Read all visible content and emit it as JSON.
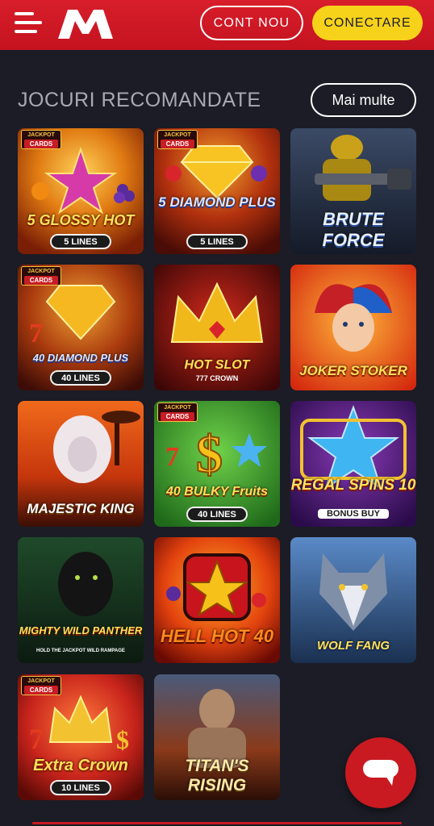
{
  "header": {
    "register_label": "CONT NOU",
    "login_label": "CONECTARE",
    "brand_color": "#d01a26",
    "login_color": "#f7d21b"
  },
  "section": {
    "title": "JOCURI RECOMANDATE",
    "more_label": "Mai multe"
  },
  "games": [
    {
      "name": "5 GLOSSY HOT",
      "badge": "JACKPOT CARDS",
      "lines": "5 LINES"
    },
    {
      "name": "5 DIAMOND PLUS",
      "badge": "JACKPOT CARDS",
      "lines": "5 LINES"
    },
    {
      "name": "BRUTE FORCE"
    },
    {
      "name": "40 DIAMOND PLUS",
      "badge": "JACKPOT CARDS",
      "lines": "40 LINES"
    },
    {
      "name": "HOT SLOT",
      "subtitle": "777 CROWN"
    },
    {
      "name": "JOKER STOKER"
    },
    {
      "name": "MAJESTIC KING"
    },
    {
      "name": "40 BULKY Fruits",
      "badge": "JACKPOT CARDS",
      "lines": "40 LINES"
    },
    {
      "name": "REGAL SPINS 10",
      "subtitle": "BONUS BUY"
    },
    {
      "name": "MIGHTY WILD PANTHER",
      "subtitle": "HOLD THE JACKPOT WILD RAMPAGE"
    },
    {
      "name": "HELL HOT 40"
    },
    {
      "name": "WOLF FANG"
    },
    {
      "name": "Extra Crown",
      "badge": "JACKPOT CARDS",
      "lines": "10 LINES"
    },
    {
      "name": "TITAN'S RISING"
    }
  ],
  "badge_parts": {
    "top": "JACKPOT",
    "bottom": "CARDS"
  },
  "icons": {
    "menu": "hamburger-icon",
    "logo": "m-logo-icon",
    "chat": "chat-bubble-icon"
  }
}
